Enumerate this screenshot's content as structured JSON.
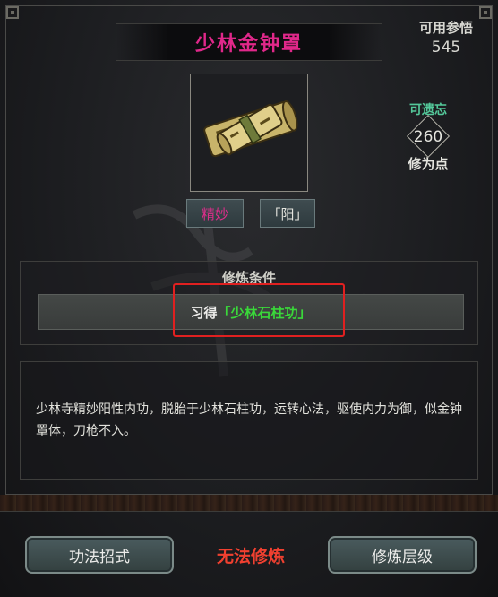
{
  "title": "少林金钟罩",
  "available": {
    "label": "可用参悟",
    "value": "545"
  },
  "forgettable": {
    "label": "可遗忘",
    "value": "260",
    "unit": "修为点"
  },
  "icon": "scroll-bundle-icon",
  "tags": [
    "精妙",
    "「阳」"
  ],
  "condition": {
    "title": "修炼条件",
    "prefix": "习得",
    "skill": "「少林石柱功」"
  },
  "description": "少林寺精妙阳性内功，脱胎于少林石柱功，运转心法，驱使内力为御，似金钟罩体，刀枪不入。",
  "footer": {
    "left_button": "功法招式",
    "status": "无法修炼",
    "right_button": "修炼层级"
  },
  "colors": {
    "title": "#e0288a",
    "tag_quality": "#e02d8c",
    "forgettable_label": "#54c89a",
    "skill_name": "#3ad83a",
    "status": "#f04030",
    "highlight_box": "#e02020"
  }
}
